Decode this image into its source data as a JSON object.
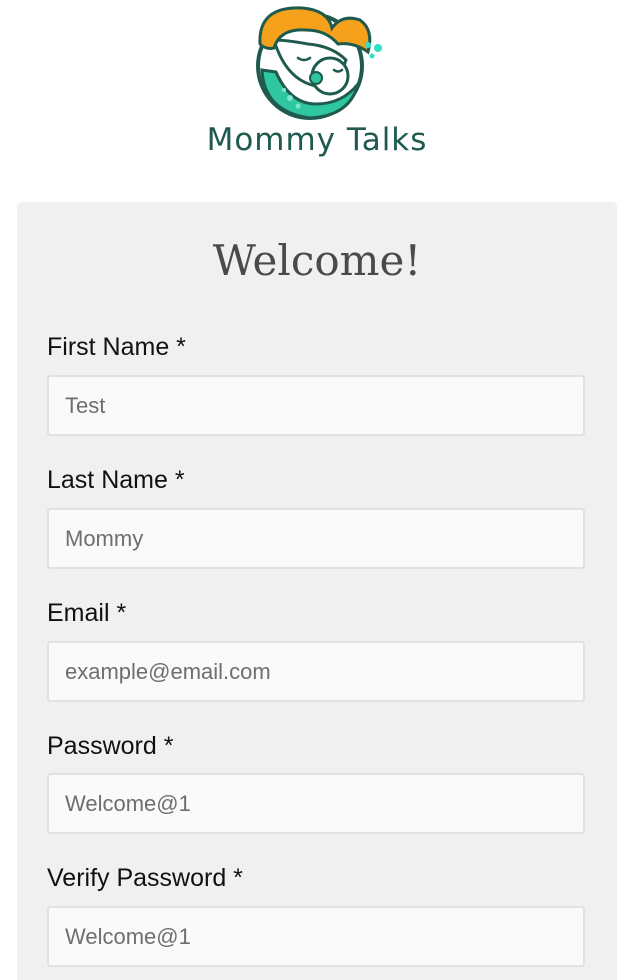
{
  "brand": {
    "name": "Mommy Talks"
  },
  "form": {
    "title": "Welcome!",
    "fields": [
      {
        "label": "First Name *",
        "placeholder": "Test"
      },
      {
        "label": "Last Name *",
        "placeholder": "Mommy"
      },
      {
        "label": "Email *",
        "placeholder": "example@email.com"
      },
      {
        "label": "Password *",
        "placeholder": "Welcome@1"
      },
      {
        "label": "Verify Password *",
        "placeholder": "Welcome@1"
      }
    ]
  },
  "colors": {
    "brand_green": "#1f5a4f",
    "brand_orange": "#f5a11c",
    "brand_teal": "#2ec7a0",
    "card_background": "#f0f0f0",
    "input_background": "#fafafa",
    "input_border": "#e1e1e1"
  }
}
